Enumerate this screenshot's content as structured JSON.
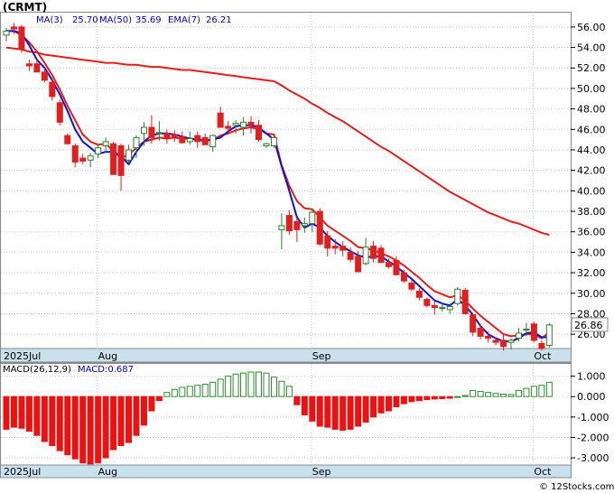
{
  "header": {
    "title": "(CRMT)",
    "ma3_label": "MA(3)",
    "ma3_value": "25.70",
    "ma50_label": "MA(50)",
    "ma50_value": "35.69",
    "ema7_label": "EMA(7)",
    "ema7_value": "26.21",
    "last_price": "26.86"
  },
  "macd_header": {
    "label": "MACD(26,12,9)",
    "value_label": "MACD:0.687"
  },
  "credit": "© 12Stocks.com",
  "colors": {
    "up": "#2e7d2e",
    "down": "#e02020",
    "ma_red": "#e02020",
    "ma_blue": "#1010d0",
    "ma_dark": "#1a1a1a",
    "axis_band": "#c8e1ec",
    "grid": "#cccccc",
    "hist_pos": "#2e8b2e",
    "hist_neg": "#ee1111",
    "label_price": "#0000cc",
    "label_macd": "#0000cc"
  },
  "chart_data": [
    {
      "type": "candlestick",
      "title": "(CRMT)",
      "ylim": [
        24.6,
        57.4
      ],
      "yticks": [
        "56.00",
        "54.00",
        "52.00",
        "50.00",
        "48.00",
        "46.00",
        "44.00",
        "42.00",
        "40.00",
        "38.00",
        "36.00",
        "34.00",
        "32.00",
        "30.00",
        "28.00",
        "26.00"
      ],
      "months": [
        "2025Jul",
        "Aug",
        "Sep",
        "Oct"
      ],
      "month_index": [
        0,
        12,
        40,
        69
      ],
      "last_price": 26.86,
      "candles": [
        [
          55.2,
          55.9,
          54.6,
          55.6
        ],
        [
          56.0,
          56.4,
          55.3,
          55.8
        ],
        [
          56.0,
          56.2,
          53.5,
          53.8
        ],
        [
          52.4,
          52.8,
          51.7,
          52.2
        ],
        [
          52.4,
          52.8,
          51.8,
          51.6
        ],
        [
          51.6,
          52.0,
          50.6,
          50.8
        ],
        [
          50.6,
          51.0,
          48.8,
          49.2
        ],
        [
          48.6,
          48.9,
          46.4,
          46.7
        ],
        [
          45.4,
          45.6,
          44.5,
          44.6
        ],
        [
          44.4,
          44.6,
          42.3,
          42.8
        ],
        [
          43.2,
          43.6,
          42.6,
          42.9
        ],
        [
          43.0,
          43.7,
          42.3,
          43.4
        ],
        [
          43.6,
          44.6,
          43.2,
          44.2
        ],
        [
          44.4,
          45.2,
          43.8,
          44.8
        ],
        [
          44.6,
          44.8,
          42.2,
          41.6
        ],
        [
          44.4,
          44.6,
          40.0,
          41.5
        ],
        [
          43.0,
          44.5,
          42.7,
          44.0
        ],
        [
          44.2,
          45.4,
          43.2,
          45.2
        ],
        [
          45.6,
          46.7,
          44.4,
          46.2
        ],
        [
          46.2,
          47.4,
          44.6,
          45.2
        ],
        [
          45.6,
          46.8,
          44.9,
          45.7
        ],
        [
          45.6,
          46.0,
          44.6,
          45.1
        ],
        [
          45.5,
          45.9,
          44.8,
          45.3
        ],
        [
          45.3,
          45.8,
          44.6,
          44.7
        ],
        [
          44.8,
          45.8,
          44.5,
          45.1
        ],
        [
          45.4,
          45.8,
          44.2,
          44.8
        ],
        [
          45.2,
          45.6,
          44.6,
          44.5
        ],
        [
          44.3,
          45.5,
          43.8,
          45.4
        ],
        [
          47.6,
          48.2,
          46.4,
          46.2
        ],
        [
          46.3,
          46.8,
          45.7,
          46.1
        ],
        [
          46.4,
          46.9,
          45.6,
          46.6
        ],
        [
          46.2,
          47.2,
          45.4,
          46.7
        ],
        [
          46.7,
          47.3,
          45.6,
          46.4
        ],
        [
          46.4,
          46.9,
          44.8,
          45.0
        ],
        [
          44.4,
          44.7,
          44.2,
          44.6
        ],
        [
          44.4,
          45.3,
          44.2,
          45.2
        ],
        [
          36.2,
          37.8,
          34.3,
          36.6
        ],
        [
          37.6,
          38.1,
          35.7,
          36.1
        ],
        [
          37.0,
          37.3,
          35.0,
          36.2
        ],
        [
          36.6,
          37.4,
          35.9,
          36.8
        ],
        [
          36.8,
          38.2,
          36.0,
          37.9
        ],
        [
          38.0,
          38.3,
          34.6,
          34.8
        ],
        [
          35.6,
          36.1,
          33.6,
          34.4
        ],
        [
          34.6,
          35.3,
          33.8,
          34.4
        ],
        [
          34.6,
          35.1,
          33.6,
          34.2
        ],
        [
          34.0,
          34.5,
          33.0,
          33.3
        ],
        [
          33.6,
          34.1,
          32.4,
          32.1
        ],
        [
          32.9,
          35.4,
          32.7,
          34.5
        ],
        [
          34.6,
          35.1,
          33.0,
          33.4
        ],
        [
          34.4,
          34.7,
          33.2,
          33.0
        ],
        [
          33.0,
          33.4,
          32.4,
          32.6
        ],
        [
          33.2,
          33.6,
          31.8,
          31.8
        ],
        [
          32.0,
          32.3,
          31.0,
          31.2
        ],
        [
          31.0,
          31.3,
          30.2,
          30.4
        ],
        [
          30.2,
          30.5,
          29.3,
          29.6
        ],
        [
          29.4,
          29.6,
          28.6,
          28.8
        ],
        [
          28.8,
          29.2,
          27.9,
          28.6
        ],
        [
          28.6,
          29.1,
          28.2,
          28.6
        ],
        [
          28.4,
          29.0,
          28.0,
          28.7
        ],
        [
          29.0,
          30.6,
          28.8,
          30.4
        ],
        [
          30.3,
          30.5,
          27.9,
          28.0
        ],
        [
          27.9,
          28.1,
          25.8,
          26.2
        ],
        [
          26.6,
          27.0,
          25.5,
          25.8
        ],
        [
          25.8,
          26.3,
          25.2,
          25.6
        ],
        [
          25.4,
          25.7,
          24.9,
          25.2
        ],
        [
          25.4,
          26.1,
          24.4,
          24.8
        ],
        [
          25.2,
          25.6,
          24.5,
          25.4
        ],
        [
          25.6,
          26.6,
          25.3,
          26.1
        ],
        [
          26.4,
          27.1,
          25.8,
          26.5
        ],
        [
          27.0,
          27.2,
          25.2,
          25.4
        ],
        [
          25.1,
          25.4,
          24.4,
          24.6
        ],
        [
          24.9,
          27.1,
          24.7,
          26.9
        ]
      ],
      "ma3": [
        55.6,
        55.6,
        55.4,
        54.2,
        52.8,
        52.0,
        50.8,
        49.4,
        47.8,
        46.0,
        44.8,
        44.2,
        43.6,
        43.8,
        43.8,
        43.4,
        42.6,
        43.8,
        44.8,
        45.4,
        45.6,
        45.6,
        45.5,
        45.3,
        45.1,
        45.0,
        44.9,
        45.0,
        45.2,
        45.8,
        46.3,
        46.4,
        46.4,
        46.2,
        45.6,
        45.0,
        42.4,
        40.0,
        37.4,
        36.4,
        36.8,
        36.4,
        35.6,
        35.0,
        34.5,
        34.1,
        33.7,
        33.5,
        33.6,
        33.6,
        33.1,
        32.6,
        32.0,
        31.4,
        30.7,
        30.0,
        29.3,
        29.0,
        28.8,
        29.4,
        28.8,
        27.9,
        26.8,
        26.0,
        25.6,
        25.3,
        25.3,
        25.6,
        26.1,
        26.2,
        25.7,
        25.7
      ],
      "ema7": [
        55.6,
        55.6,
        55.2,
        54.5,
        53.6,
        52.5,
        51.3,
        49.9,
        48.3,
        46.9,
        45.5,
        44.8,
        44.5,
        44.6,
        43.9,
        43.2,
        43.5,
        44.2,
        44.8,
        45.0,
        45.2,
        45.1,
        45.2,
        45.1,
        45.1,
        45.0,
        44.9,
        45.0,
        45.4,
        45.6,
        45.9,
        46.1,
        46.2,
        46.0,
        45.6,
        45.5,
        42.5,
        40.5,
        39.0,
        38.3,
        38.2,
        37.4,
        36.6,
        36.1,
        35.6,
        35.1,
        34.5,
        34.4,
        34.2,
        33.9,
        33.6,
        33.2,
        32.7,
        32.1,
        31.5,
        30.8,
        30.2,
        29.9,
        29.6,
        29.8,
        29.3,
        28.5,
        27.8,
        27.2,
        26.6,
        26.0,
        25.8,
        25.9,
        26.0,
        26.0,
        25.6,
        26.2
      ],
      "ma50": [
        54.0,
        53.9,
        53.8,
        53.6,
        53.5,
        53.3,
        53.2,
        53.1,
        53.0,
        52.9,
        52.8,
        52.7,
        52.6,
        52.5,
        52.5,
        52.4,
        52.3,
        52.3,
        52.2,
        52.1,
        52.1,
        52.0,
        51.9,
        51.8,
        51.8,
        51.7,
        51.6,
        51.5,
        51.4,
        51.3,
        51.2,
        51.1,
        51.0,
        50.9,
        50.8,
        50.7,
        50.3,
        49.8,
        49.4,
        49.0,
        48.5,
        48.1,
        47.6,
        47.2,
        46.8,
        46.3,
        45.8,
        45.3,
        44.8,
        44.3,
        43.9,
        43.4,
        42.9,
        42.4,
        41.9,
        41.4,
        40.9,
        40.4,
        39.9,
        39.5,
        39.1,
        38.7,
        38.3,
        37.9,
        37.6,
        37.3,
        37.0,
        36.8,
        36.5,
        36.2,
        35.9,
        35.7
      ]
    },
    {
      "type": "bar",
      "title": "MACD(26,12,9)",
      "ylim": [
        -3.35,
        1.6
      ],
      "yticks": [
        "1.000",
        "0.000",
        "-1.000",
        "-2.000",
        "-3.000"
      ],
      "months": [
        "2025Jul",
        "Aug",
        "Sep",
        "Oct"
      ],
      "values": [
        -1.6,
        -1.5,
        -1.55,
        -1.7,
        -1.9,
        -2.2,
        -2.4,
        -2.65,
        -2.85,
        -3.05,
        -3.25,
        -3.3,
        -3.25,
        -3.0,
        -2.6,
        -2.4,
        -2.25,
        -1.9,
        -1.4,
        -0.7,
        -0.2,
        0.2,
        0.35,
        0.45,
        0.5,
        0.55,
        0.6,
        0.7,
        0.85,
        1.0,
        1.1,
        1.15,
        1.2,
        1.2,
        1.15,
        0.95,
        0.75,
        0.5,
        -0.4,
        -0.9,
        -1.2,
        -1.45,
        -1.5,
        -1.6,
        -1.65,
        -1.6,
        -1.45,
        -1.25,
        -1.0,
        -0.8,
        -0.7,
        -0.5,
        -0.35,
        -0.25,
        -0.2,
        -0.15,
        -0.12,
        -0.1,
        -0.08,
        0.0,
        0.05,
        0.3,
        0.25,
        0.2,
        0.15,
        0.12,
        0.1,
        0.3,
        0.4,
        0.5,
        0.55,
        0.7
      ]
    }
  ]
}
